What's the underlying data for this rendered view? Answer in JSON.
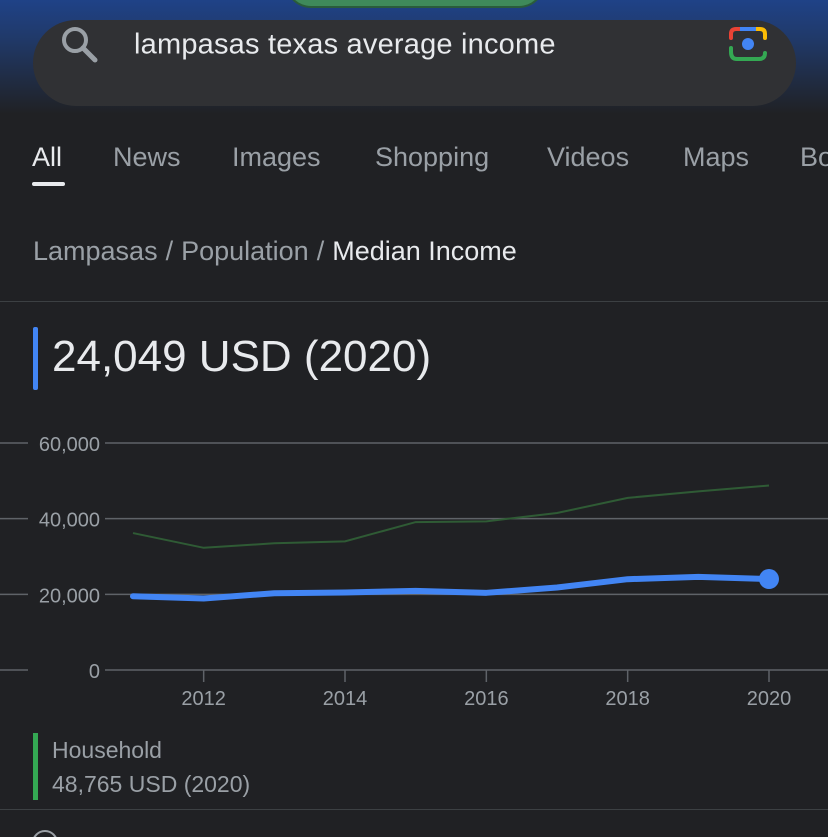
{
  "search": {
    "query": "lampasas texas average income",
    "icons": {
      "search": "search-icon",
      "lens": "google-lens-icon"
    }
  },
  "tabs": [
    {
      "label": "All",
      "active": true
    },
    {
      "label": "News"
    },
    {
      "label": "Images"
    },
    {
      "label": "Shopping"
    },
    {
      "label": "Videos"
    },
    {
      "label": "Maps"
    },
    {
      "label": "Bo"
    }
  ],
  "breadcrumb": {
    "items": [
      "Lampasas",
      "Population",
      "Median Income"
    ],
    "separator": "/"
  },
  "headline": "24,049 USD (2020)",
  "legend": {
    "name": "Household",
    "value": "48,765 USD (2020)"
  },
  "colors": {
    "accent": "#4285f4",
    "household": "#34a853",
    "household_line": "#2f5b35",
    "background": "#202124"
  },
  "chart_data": {
    "type": "line",
    "x": [
      2011,
      2012,
      2013,
      2014,
      2015,
      2016,
      2017,
      2018,
      2019,
      2020
    ],
    "xticks": [
      2012,
      2014,
      2016,
      2018,
      2020
    ],
    "yticks": [
      0,
      20000,
      40000,
      60000
    ],
    "ytick_labels": [
      "0",
      "20,000",
      "40,000",
      "60,000"
    ],
    "ylim": [
      0,
      60000
    ],
    "grid": true,
    "series": [
      {
        "values": [
          19500,
          18900,
          20300,
          20500,
          20900,
          20400,
          21800,
          24000,
          24600,
          24049
        ],
        "color": "#4285f4",
        "highlight_last": true
      },
      {
        "name": "Household",
        "values": [
          36200,
          32300,
          33500,
          34000,
          39100,
          39300,
          41500,
          45500,
          47200,
          48765
        ],
        "color": "#2f5b35"
      }
    ]
  }
}
